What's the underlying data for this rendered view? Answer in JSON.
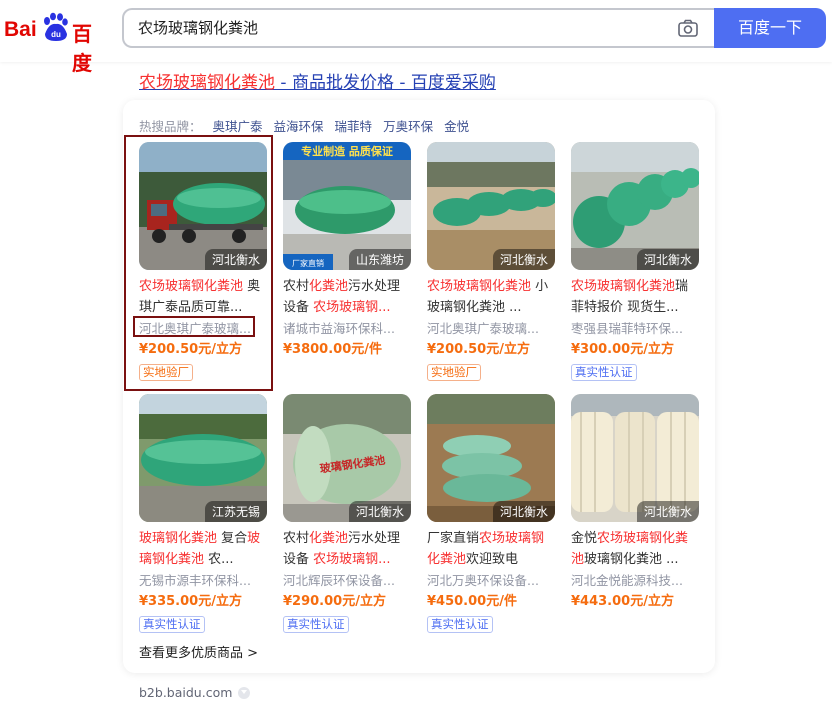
{
  "logo": {
    "bai": "Bai",
    "du": "du",
    "cn": "百度"
  },
  "search": {
    "query": "农场玻璃钢化粪池",
    "button_label": "百度一下"
  },
  "result": {
    "title_hl": "农场玻璃钢化粪池",
    "title_rest": " - 商品批发价格 - 百度爱采购"
  },
  "brands": {
    "label": "热搜品牌：",
    "items": [
      "奥琪广泰",
      "益海环保",
      "瑞菲特",
      "万奥环保",
      "金悦"
    ]
  },
  "products": [
    {
      "loc": "河北衡水",
      "title_hl": "农场玻璃钢化粪池",
      "title_rest": " 奥琪广泰品质可靠...",
      "company": "河北奥琪广泰玻璃...",
      "price": "¥200.50元/立方",
      "badge": "实地验厂",
      "badge_color": "#f56c0f"
    },
    {
      "loc": "山东潍坊",
      "title_pre": "农村",
      "title_hl": "化粪池",
      "title_rest": "污水处理设备 ",
      "title_hl2": "农场玻璃钢...",
      "company": "诸城市益海环保科...",
      "price": "¥3800.00元/件"
    },
    {
      "loc": "河北衡水",
      "title_hl": "农场玻璃钢化粪池",
      "title_rest": " 小玻璃钢化粪池 ...",
      "company": "河北奥琪广泰玻璃...",
      "price": "¥200.50元/立方",
      "badge": "实地验厂",
      "badge_color": "#f56c0f"
    },
    {
      "loc": "河北衡水",
      "title_hl": "农场玻璃钢化粪池",
      "title_rest": "瑞菲特报价 现货生...",
      "company": "枣强县瑞菲特环保...",
      "price": "¥300.00元/立方",
      "badge": "真实性认证",
      "badge_color": "#4e6ef2"
    },
    {
      "loc": "江苏无锡",
      "title_hl": "玻璃钢化粪池",
      "title_rest": " 复合",
      "title_hl2": "玻璃钢化粪池",
      "title_rest2": " 农...",
      "company": "无锡市源丰环保科...",
      "price": "¥335.00元/立方",
      "badge": "真实性认证",
      "badge_color": "#4e6ef2"
    },
    {
      "loc": "河北衡水",
      "title_pre": "农村",
      "title_hl": "化粪池",
      "title_rest": "污水处理设备 ",
      "title_hl2": "农场玻璃钢...",
      "company": "河北辉辰环保设备...",
      "price": "¥290.00元/立方",
      "badge": "真实性认证",
      "badge_color": "#4e6ef2"
    },
    {
      "loc": "河北衡水",
      "title_pre": "厂家直销",
      "title_hl": "农场玻璃钢化粪池",
      "title_rest": "欢迎致电",
      "company": "河北万奥环保设备...",
      "price": "¥450.00元/件",
      "badge": "真实性认证",
      "badge_color": "#4e6ef2"
    },
    {
      "loc": "河北衡水",
      "title_pre": "金悦",
      "title_hl": "农场玻璃钢化粪池",
      "title_rest": "玻璃钢化粪池 ...",
      "company": "河北金悦能源科技...",
      "price": "¥443.00元/立方"
    }
  ],
  "thumb_text": {
    "p1_banner": "专业制造 品质保证",
    "p1_footer": "厂家直销",
    "p5_tank": "玻璃钢化粪池"
  },
  "more_link": "查看更多优质商品 >",
  "source": "b2b.baidu.com",
  "colors": {
    "accent": "#4e6ef2",
    "highlight": "#f73131",
    "price": "#f56c0f",
    "annotation": "#7a1010"
  }
}
